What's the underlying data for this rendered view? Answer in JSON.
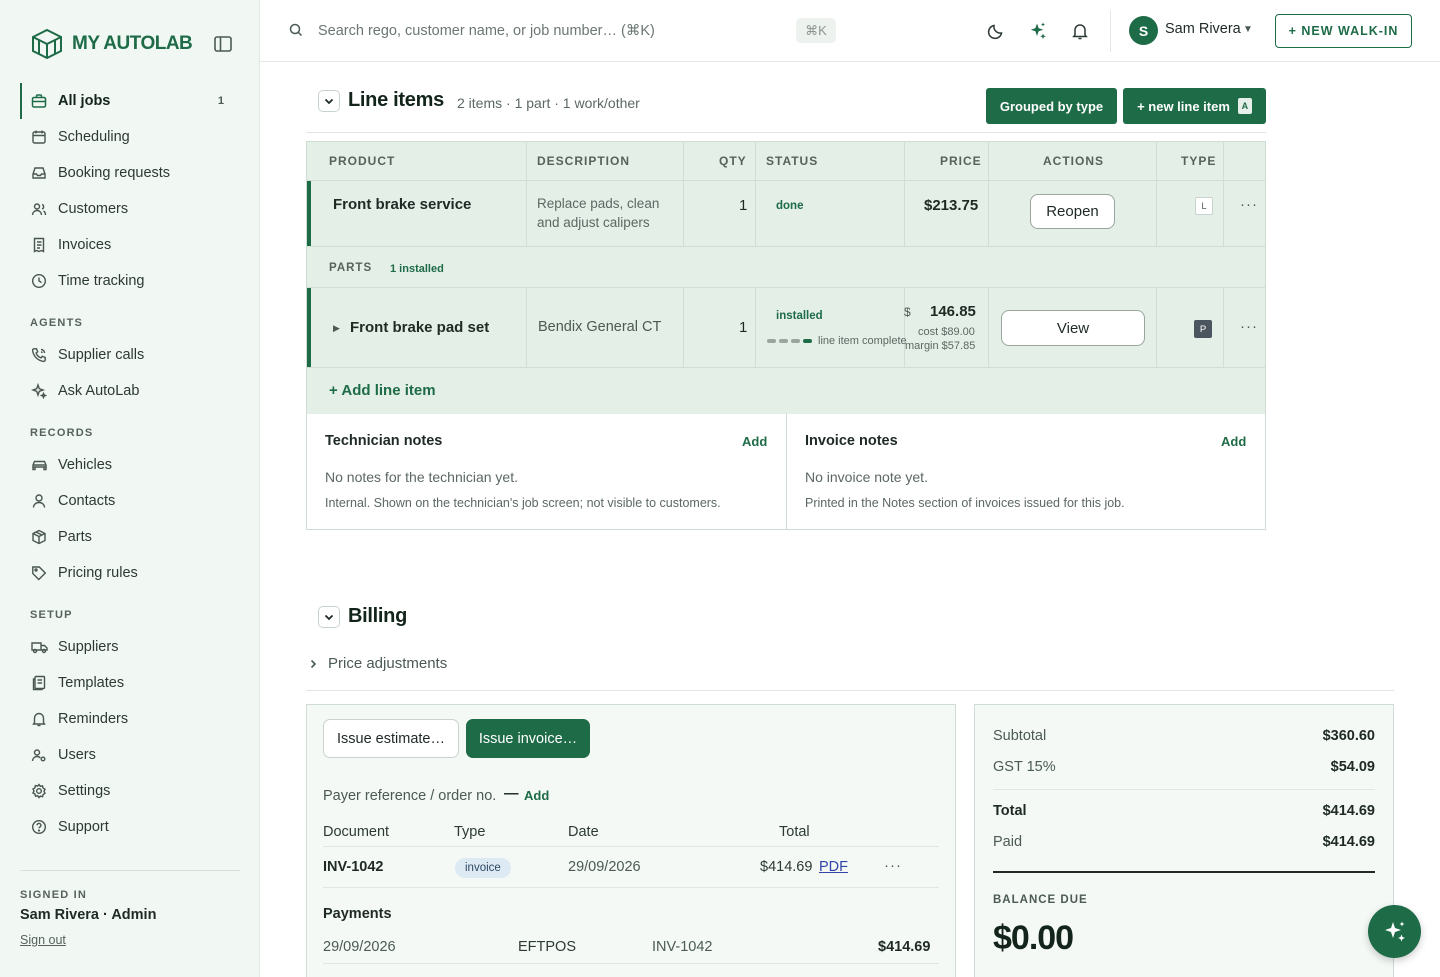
{
  "brand": {
    "name_my": "MY ",
    "name_auto": "AUTOLAB",
    "accent_color": "#1e6b47"
  },
  "sidebar": {
    "items_main": [
      {
        "label": "All jobs",
        "icon": "briefcase-icon",
        "count": "1",
        "active": true
      },
      {
        "label": "Scheduling",
        "icon": "calendar-icon"
      },
      {
        "label": "Booking requests",
        "icon": "inbox-icon"
      },
      {
        "label": "Customers",
        "icon": "users-icon"
      },
      {
        "label": "Invoices",
        "icon": "receipt-icon"
      },
      {
        "label": "Time tracking",
        "icon": "clock-icon"
      }
    ],
    "section_agents": "AGENTS",
    "items_agents": [
      {
        "label": "Supplier calls",
        "icon": "phone-icon"
      },
      {
        "label": "Ask AutoLab",
        "icon": "sparkle-icon"
      }
    ],
    "section_records": "RECORDS",
    "items_records": [
      {
        "label": "Vehicles",
        "icon": "car-icon"
      },
      {
        "label": "Contacts",
        "icon": "person-icon"
      },
      {
        "label": "Parts",
        "icon": "box-icon"
      },
      {
        "label": "Pricing rules",
        "icon": "tag-icon"
      }
    ],
    "section_setup": "SETUP",
    "items_setup": [
      {
        "label": "Suppliers",
        "icon": "truck-icon"
      },
      {
        "label": "Templates",
        "icon": "template-icon"
      },
      {
        "label": "Reminders",
        "icon": "bell-icon"
      },
      {
        "label": "Users",
        "icon": "users-cog-icon"
      },
      {
        "label": "Settings",
        "icon": "gear-icon"
      },
      {
        "label": "Support",
        "icon": "help-icon"
      }
    ],
    "signed_in_label": "SIGNED IN",
    "signed_in_user": "Sam Rivera · Admin",
    "sign_out": "Sign out"
  },
  "topbar": {
    "search_placeholder": "Search rego, customer name, or job number… (⌘K)",
    "kbd_hint": "⌘K",
    "user_initial": "S",
    "user_name": "Sam Rivera",
    "walkin_label": "+ NEW WALK-IN"
  },
  "line_items": {
    "title": "Line items",
    "subtitle": "2 items · 1 part · 1 work/other",
    "grouped_btn": "Grouped by type",
    "new_btn": "+ new line item",
    "new_kbd": "A",
    "columns": [
      "PRODUCT",
      "DESCRIPTION",
      "QTY",
      "STATUS",
      "PRICE",
      "ACTIONS",
      "TYPE"
    ],
    "service": {
      "product": "Front brake service",
      "description": "Replace pads, clean and adjust calipers",
      "qty": "1",
      "status": "done",
      "price": "$213.75",
      "action": "Reopen",
      "type": "L"
    },
    "parts_label": "PARTS",
    "parts_count": "1 installed",
    "part": {
      "product": "Front brake pad set",
      "description": "Bendix General CT",
      "qty": "1",
      "status": "installed",
      "progress_note": "line item complete",
      "progress_steps": 4,
      "progress_done": 4,
      "price_currency": "$",
      "price": "146.85",
      "cost": "cost $89.00",
      "margin": "margin $57.85",
      "action": "View",
      "type": "P"
    },
    "add_line": "+ Add line item",
    "tech_notes": {
      "title": "Technician notes",
      "add": "Add",
      "empty": "No notes for the technician yet.",
      "help": "Internal. Shown on the technician's job screen; not visible to customers."
    },
    "invoice_notes": {
      "title": "Invoice notes",
      "add": "Add",
      "empty": "No invoice note yet.",
      "help": "Printed in the Notes section of invoices issued for this job."
    }
  },
  "billing": {
    "title": "Billing",
    "price_adjustments": "Price adjustments",
    "issue_estimate": "Issue estimate…",
    "issue_invoice": "Issue invoice…",
    "payer_ref_label": "Payer reference / order no.",
    "payer_ref_value": "—",
    "payer_ref_add": "Add",
    "doc_headers": {
      "document": "Document",
      "type": "Type",
      "date": "Date",
      "total": "Total"
    },
    "document": {
      "number": "INV-1042",
      "type": "invoice",
      "date": "29/09/2026",
      "total": "$414.69",
      "pdf": "PDF"
    },
    "payments_label": "Payments",
    "payment": {
      "date": "29/09/2026",
      "method": "EFTPOS",
      "ref": "INV-1042",
      "amount": "$414.69"
    },
    "summary": {
      "subtotal_label": "Subtotal",
      "subtotal": "$360.60",
      "gst_label": "GST 15%",
      "gst": "$54.09",
      "total_label": "Total",
      "total": "$414.69",
      "paid_label": "Paid",
      "paid": "$414.69",
      "balance_label": "BALANCE DUE",
      "balance": "$0.00"
    }
  }
}
